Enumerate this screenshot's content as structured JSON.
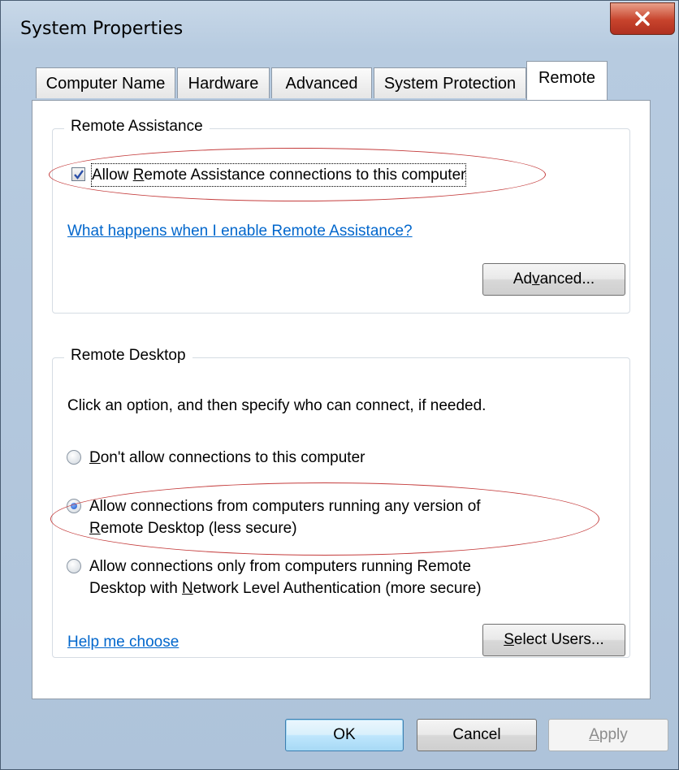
{
  "window": {
    "title": "System Properties",
    "close_label": "X"
  },
  "tabs": [
    {
      "label": "Computer Name"
    },
    {
      "label": "Hardware"
    },
    {
      "label": "Advanced"
    },
    {
      "label": "System Protection"
    },
    {
      "label": "Remote"
    }
  ],
  "remote_assistance": {
    "group_title": "Remote Assistance",
    "checkbox_label_pre": "Allow ",
    "checkbox_label_u": "R",
    "checkbox_label_post": "emote Assistance connections to this computer",
    "checked": true,
    "help_link": "What happens when I enable Remote Assistance?",
    "advanced_pre": "Ad",
    "advanced_u": "v",
    "advanced_post": "anced..."
  },
  "remote_desktop": {
    "group_title": "Remote Desktop",
    "instruction": "Click an option, and then specify who can connect, if needed.",
    "option1_u": "D",
    "option1_post": "on't allow connections to this computer",
    "option2_line1": "Allow connections from computers running any version of",
    "option2_line2_u": "R",
    "option2_line2_post": "emote Desktop (less secure)",
    "option3_line1": "Allow connections only from computers running Remote",
    "option3_line2_pre": "Desktop with ",
    "option3_line2_u": "N",
    "option3_line2_post": "etwork Level Authentication (more secure)",
    "selected_option": 2,
    "help_link": "Help me choose",
    "select_users_u": "S",
    "select_users_post": "elect Users..."
  },
  "footer": {
    "ok": "OK",
    "cancel": "Cancel",
    "apply_u": "A",
    "apply_post": "pply"
  }
}
